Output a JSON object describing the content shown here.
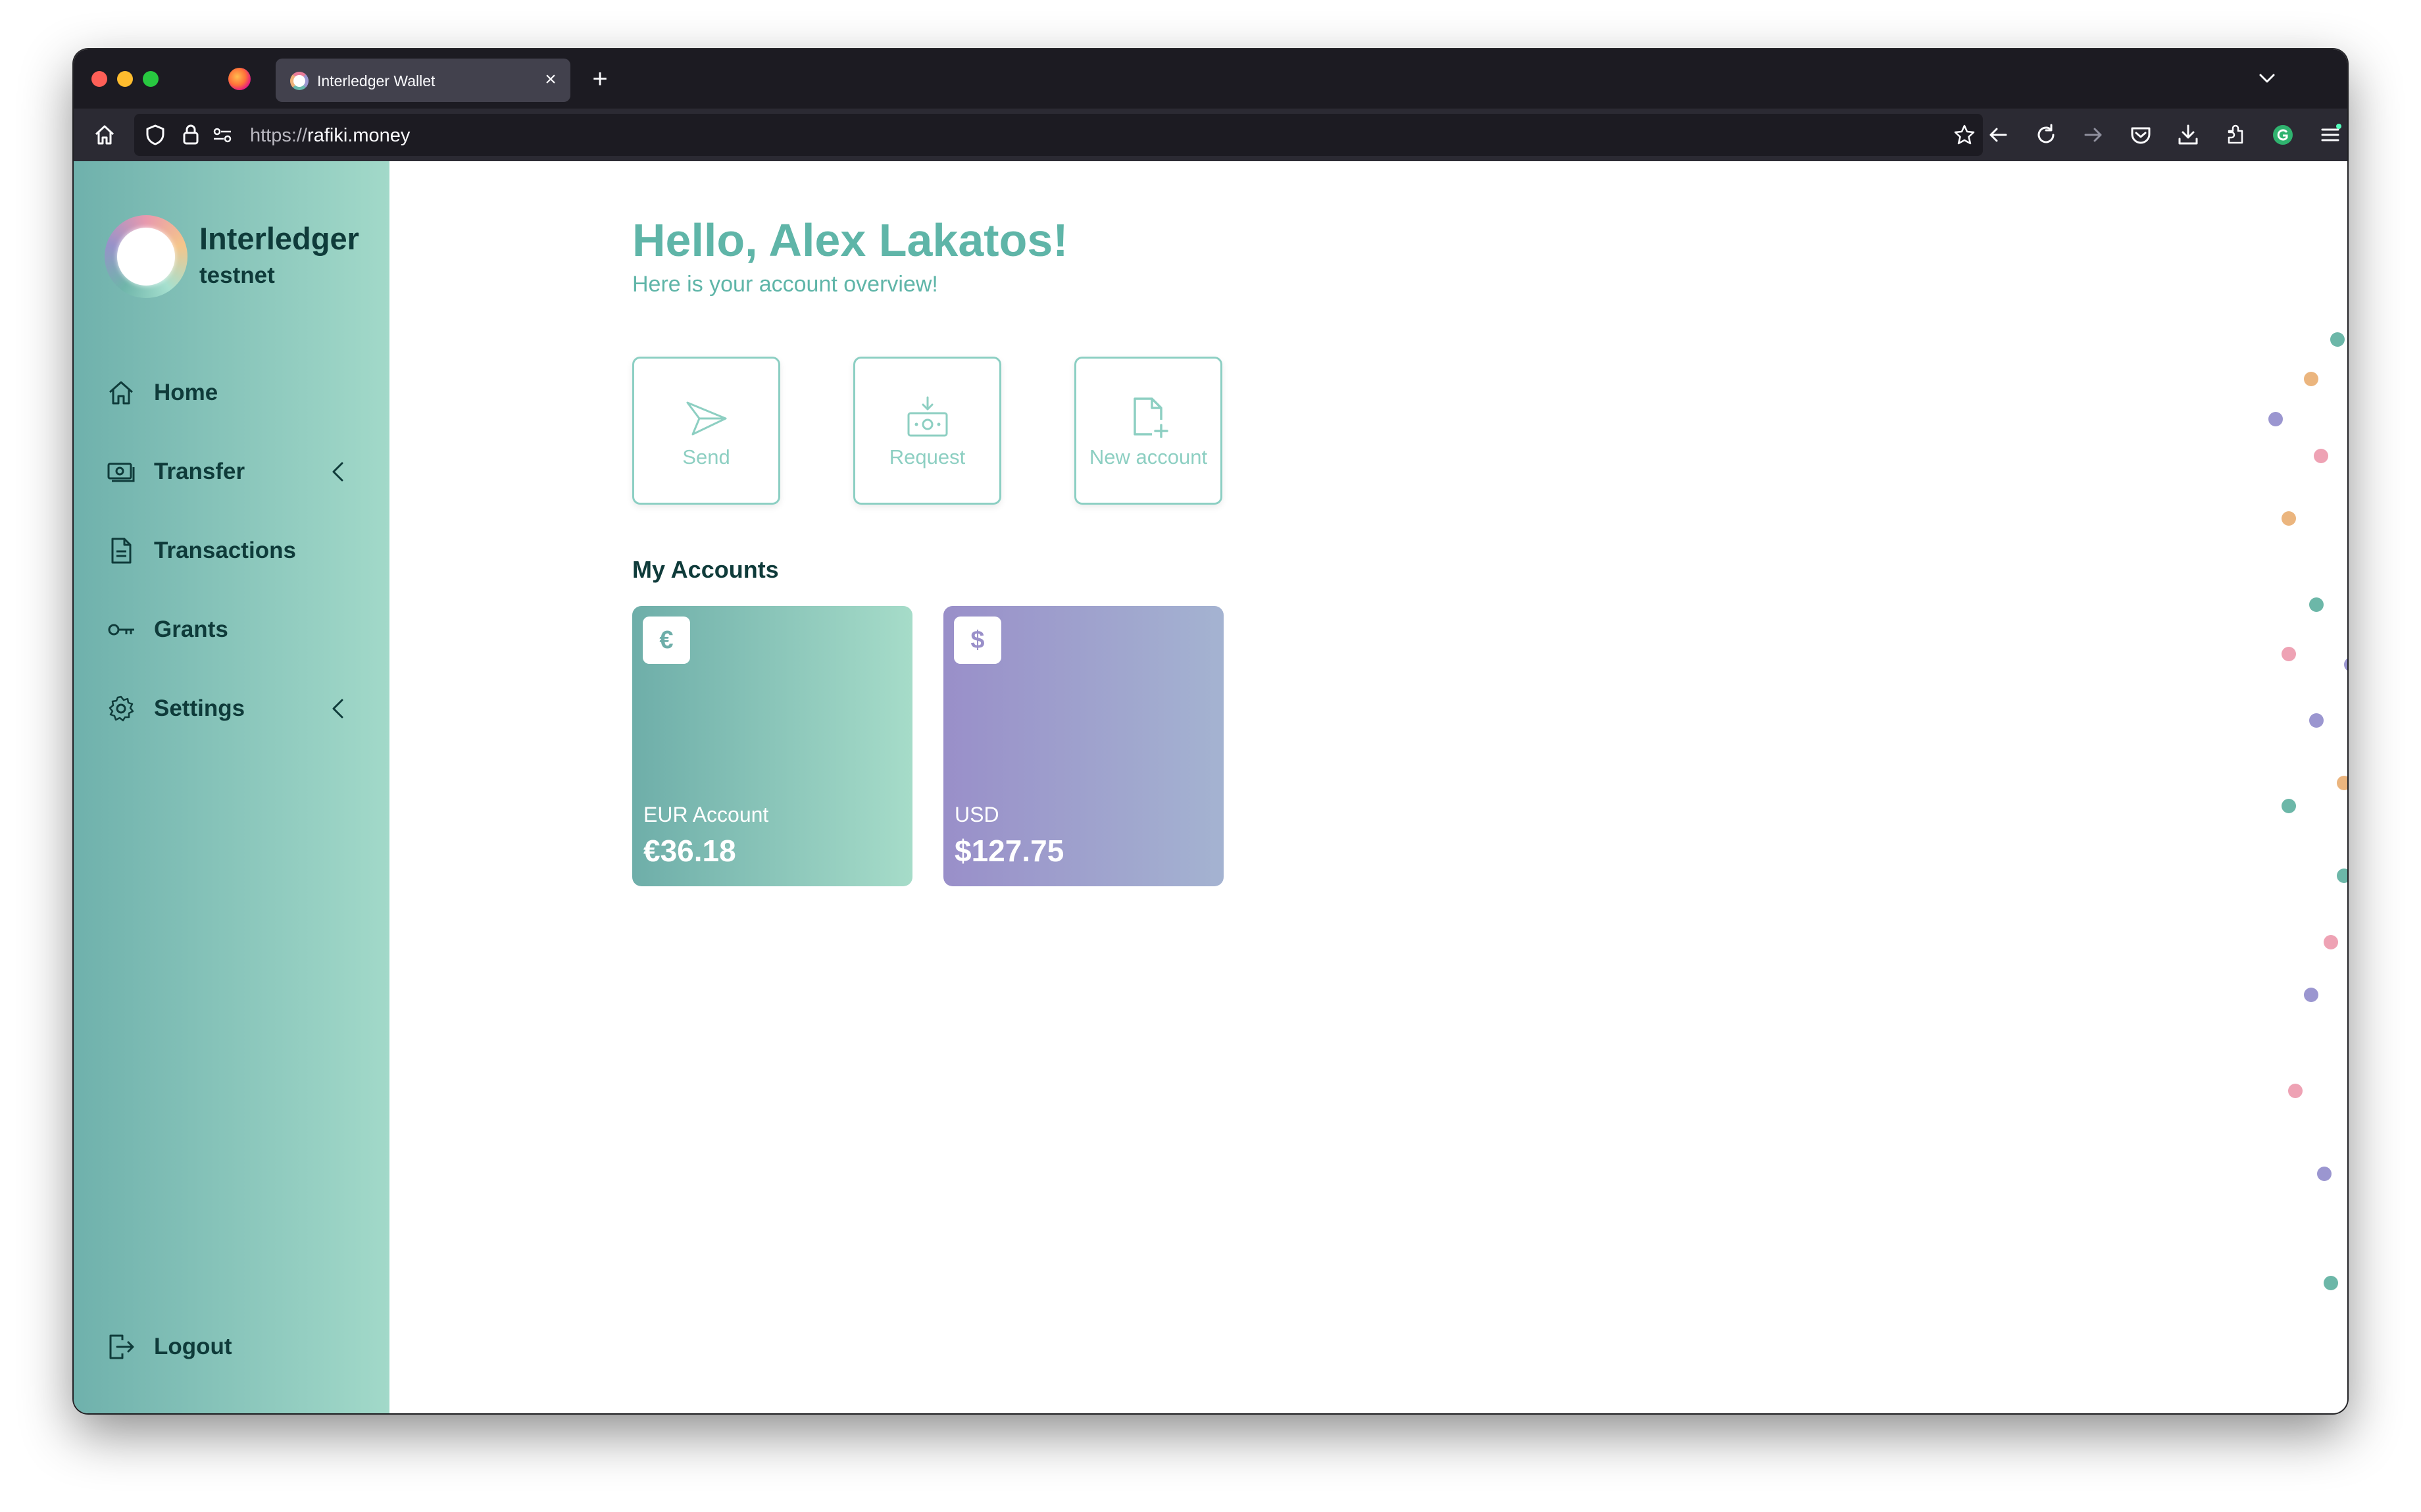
{
  "browser": {
    "tab_title": "Interledger Wallet",
    "url_scheme": "https://",
    "url_host": "rafiki.money"
  },
  "sidebar": {
    "brand": "Interledger",
    "brand_sub": "testnet",
    "items": [
      {
        "label": "Home",
        "icon": "home-icon"
      },
      {
        "label": "Transfer",
        "icon": "money-icon",
        "expandable": true
      },
      {
        "label": "Transactions",
        "icon": "document-icon"
      },
      {
        "label": "Grants",
        "icon": "key-icon"
      },
      {
        "label": "Settings",
        "icon": "gear-icon",
        "expandable": true
      }
    ],
    "logout": "Logout"
  },
  "main": {
    "greeting": "Hello, Alex Lakatos!",
    "subtitle": "Here is your account overview!",
    "actions": [
      {
        "label": "Send",
        "icon": "paper-plane-icon"
      },
      {
        "label": "Request",
        "icon": "request-money-icon"
      },
      {
        "label": "New account",
        "icon": "new-file-icon"
      }
    ],
    "accounts_title": "My Accounts",
    "accounts": [
      {
        "symbol": "€",
        "name": "EUR Account",
        "balance": "€36.18"
      },
      {
        "symbol": "$",
        "name": "USD",
        "balance": "$127.75"
      }
    ]
  },
  "colors": {
    "accent": "#5fb5a8",
    "dark_text": "#0f3b3a",
    "eur_card_from": "#6eaea9",
    "eur_card_to": "#a6dcc9",
    "usd_card_from": "#998fc9",
    "usd_card_to": "#a4b3d1",
    "dot_teal": "#6cb7a8",
    "dot_purple": "#9b96d0",
    "dot_pink": "#eea2b4",
    "dot_orange": "#ebb57e"
  }
}
